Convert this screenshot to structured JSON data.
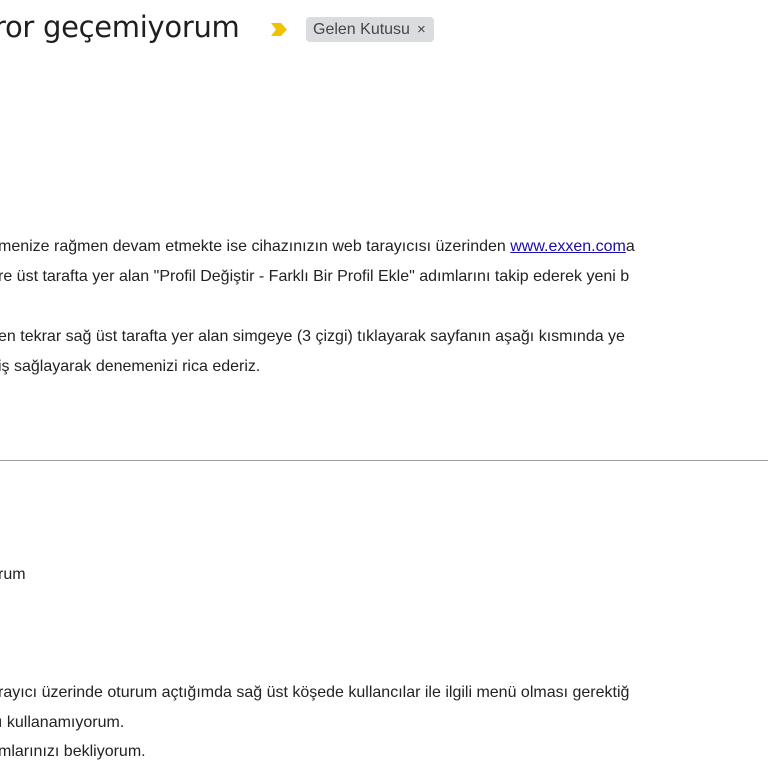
{
  "header": {
    "subject": "ror geçemiyorum",
    "importance_icon": "importance-marker-icon",
    "label_chip": {
      "label": "Gelen Kutusu",
      "remove": "×"
    }
  },
  "reply": {
    "line1_before": "menize rağmen devam etmekte ise cihazınızın web tarayıcısı üzerinden ",
    "line1_link": "www.exxen.com",
    "line1_after": "a",
    "line2": "re üst tarafta yer alan \"Profil Değiştir - Farklı Bir Profil Ekle\" adımlarını takip ederek yeni b",
    "line3": "en tekrar sağ üst tarafta yer alan simgeye (3 çizgi) tıklayarak sayfanın aşağı kısmında ye",
    "line4": "iş sağlayarak denemenizi rica ederiz."
  },
  "original": {
    "subject_fragment": "rum",
    "line1": "rayıcı üzerinde oturum açtığımda sağ üst köşede kullancılar ile ilgili menü olması gerektiğ",
    "line2": "ı kullanamıyorum.",
    "line3": "mlarınızı bekliyorum."
  },
  "colors": {
    "importance": "#f2c100",
    "link": "#1a0dab",
    "chip_bg": "#dadce0",
    "divider": "#9e9e9e"
  }
}
